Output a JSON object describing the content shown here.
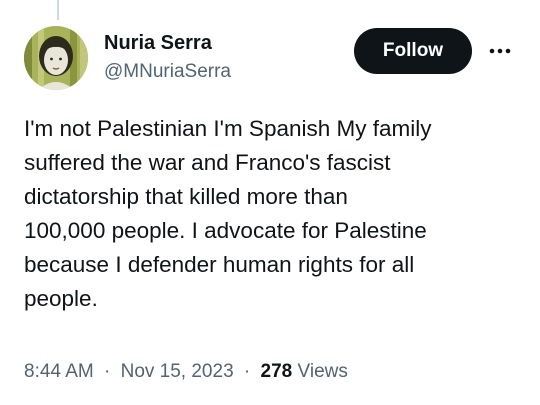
{
  "author": {
    "display_name": "Nuria Serra",
    "handle": "@MNuriaSerra"
  },
  "actions": {
    "follow_label": "Follow",
    "more_icon": "more-horizontal-icon"
  },
  "tweet": {
    "lines": [
      "I'm not Palestinian I'm Spanish My family",
      "suffered the war and Franco's fascist",
      "dictatorship that killed more than",
      "100,000 people. I advocate for Palestine",
      "because I defender human rights for all",
      "people."
    ]
  },
  "meta": {
    "time": "8:44 AM",
    "separator": "·",
    "date": "Nov 15, 2023",
    "views_count": "278",
    "views_label": "Views"
  },
  "colors": {
    "text_primary": "#0f1419",
    "text_secondary": "#536471",
    "follow_bg": "#0f1419",
    "follow_text": "#ffffff",
    "thread_line": "#cfd9de"
  }
}
